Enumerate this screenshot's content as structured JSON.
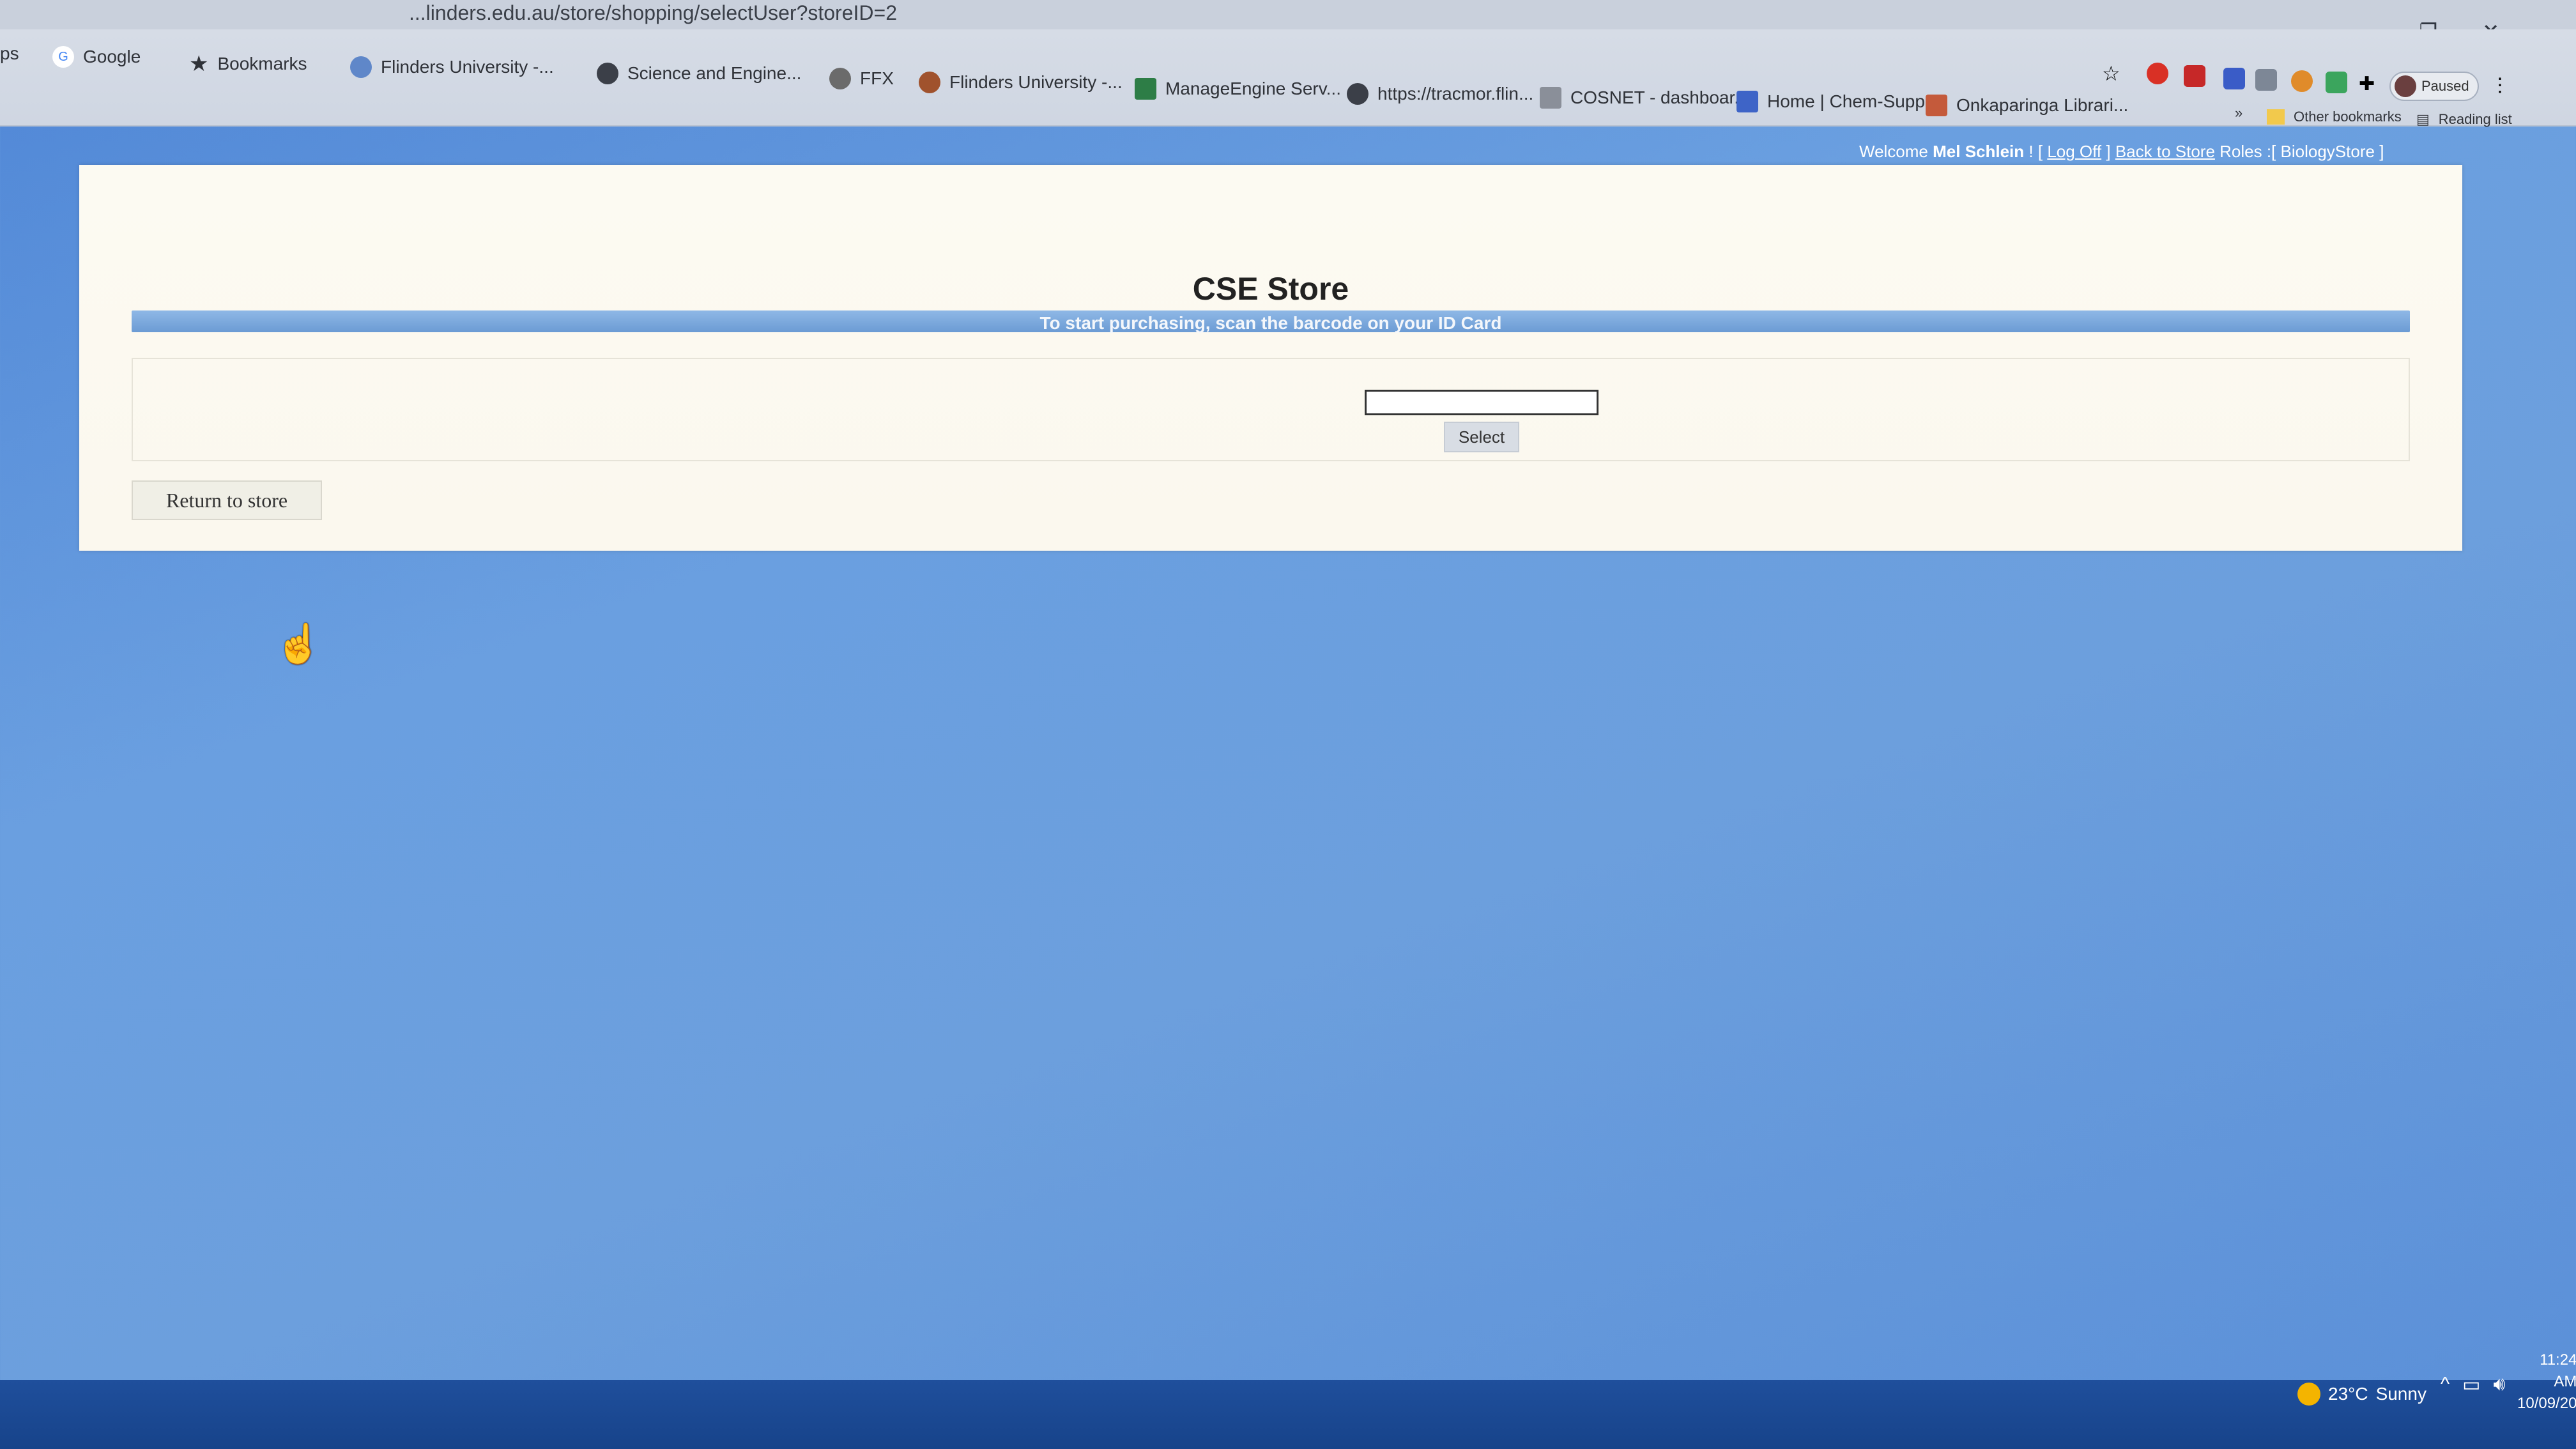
{
  "browser": {
    "url": "...linders.edu.au/store/shopping/selectUser?storeID=2",
    "bookmarks": [
      "ps",
      "Google",
      "Bookmarks",
      "Flinders University -...",
      "Science and Engine...",
      "FFX",
      "Flinders University -...",
      "ManageEngine Serv...",
      "https://tracmor.flin...",
      "COSNET - dashboar...",
      "Home | Chem-Supp...",
      "Onkaparinga Librari..."
    ],
    "other_bookmarks": "Other bookmarks",
    "reading_list": "Reading list",
    "profile_status": "Paused"
  },
  "header": {
    "welcome": "Welcome",
    "user_name": "Mel Schlein",
    "separator": "! [",
    "log_off": "Log Off",
    "close_bracket": "]",
    "back_to_store": "Back to Store",
    "roles_label": "Roles :[",
    "role": "BiologyStore",
    "roles_close": "]"
  },
  "main": {
    "title": "CSE Store",
    "instruction": "To start purchasing, scan the barcode on your ID Card",
    "barcode_value": "",
    "select_label": "Select",
    "return_label": "Return to store"
  },
  "taskbar": {
    "temperature": "23°C",
    "condition": "Sunny",
    "time": "11:24 AM",
    "date": "10/09/20"
  },
  "colors": {
    "desktop": "#6a9fe0",
    "panel": "#fcfaf2",
    "banner": "#7aa8dc"
  }
}
